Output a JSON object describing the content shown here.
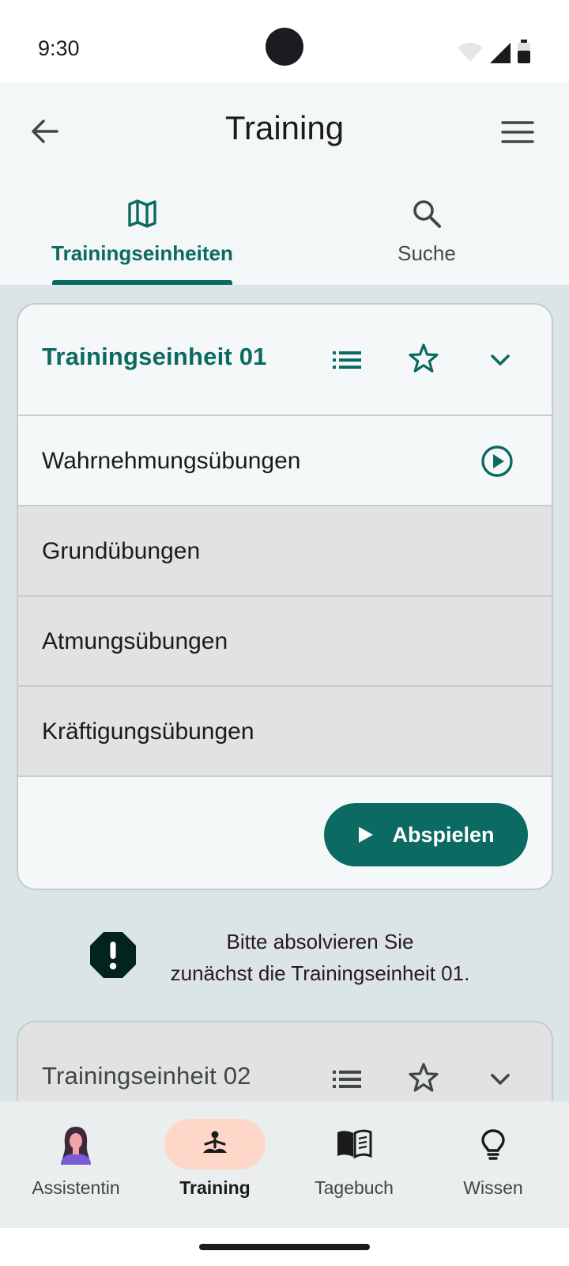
{
  "status_bar": {
    "time": "9:30"
  },
  "app_bar": {
    "title": "Training"
  },
  "tabs": [
    {
      "label": "Trainingseinheiten",
      "icon": "map-icon",
      "selected": true
    },
    {
      "label": "Suche",
      "icon": "search-icon",
      "selected": false
    }
  ],
  "unit1": {
    "title": "Trainingseinheit 01",
    "exercises": [
      {
        "label": "Wahrnehmungsübungen",
        "state": "active"
      },
      {
        "label": "Grundübungen",
        "state": "locked"
      },
      {
        "label": "Atmungsübungen",
        "state": "locked"
      },
      {
        "label": "Kräftigungsübungen",
        "state": "locked"
      }
    ],
    "play_label": "Abspielen"
  },
  "notice": {
    "line1": "Bitte absolvieren Sie",
    "line2": "zunächst die Trainingseinheit 01."
  },
  "unit2": {
    "title": "Trainingseinheit 02"
  },
  "bottom_nav": [
    {
      "label": "Assistentin",
      "icon": "assistant-avatar-icon",
      "selected": false
    },
    {
      "label": "Training",
      "icon": "meditation-icon",
      "selected": true
    },
    {
      "label": "Tagebuch",
      "icon": "book-icon",
      "selected": false
    },
    {
      "label": "Wissen",
      "icon": "lightbulb-icon",
      "selected": false
    }
  ],
  "colors": {
    "primary": "#0b6a61",
    "surface": "#f5f8f8",
    "background": "#dbe4e6",
    "locked_row": "#e2e2e2",
    "nav_active_pill": "#ffd7c8"
  }
}
